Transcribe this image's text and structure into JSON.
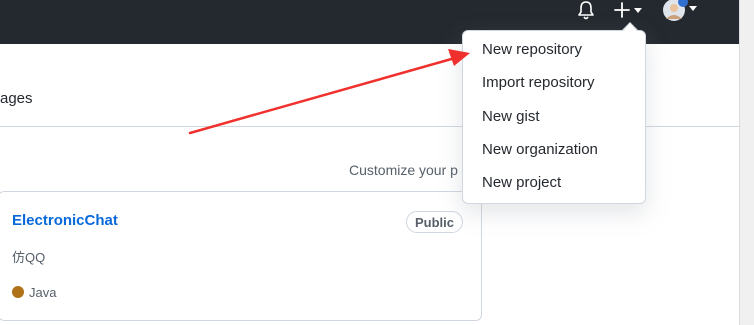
{
  "header": {
    "notifications_icon": "bell-icon",
    "create_icon": "plus-icon",
    "avatar_icon": "user-avatar"
  },
  "nav": {
    "packages_label_partial": "ages"
  },
  "main": {
    "customize_label": "Customize your p"
  },
  "repo_card": {
    "name": "ElectronicChat",
    "visibility": "Public",
    "description": "仿QQ",
    "language": "Java",
    "language_color": "#b07219"
  },
  "create_menu": {
    "items": [
      {
        "label": "New repository"
      },
      {
        "label": "Import repository"
      },
      {
        "label": "New gist"
      },
      {
        "label": "New organization"
      },
      {
        "label": "New project"
      }
    ]
  },
  "annotation": {
    "arrow_color": "#f0302c"
  }
}
